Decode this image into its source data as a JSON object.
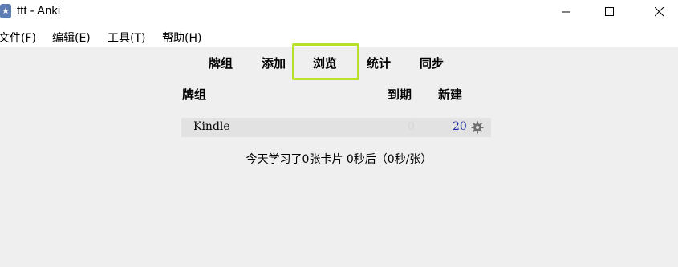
{
  "window": {
    "title": "ttt - Anki",
    "icon": "anki-star-icon"
  },
  "menu": {
    "items": [
      "文件(F)",
      "编辑(E)",
      "工具(T)",
      "帮助(H)"
    ]
  },
  "toolbar": {
    "items": [
      "牌组",
      "添加",
      "浏览",
      "统计",
      "同步"
    ],
    "highlighted": "浏览",
    "highlight_color": "#b8e02a"
  },
  "deck_table": {
    "headers": {
      "deck": "牌组",
      "due": "到期",
      "new": "新建"
    },
    "rows": [
      {
        "name": "Kindle",
        "due": "0",
        "new": "20"
      }
    ],
    "due_color": "#d6d6d6",
    "new_color": "#1f2ba3"
  },
  "stats": {
    "text": "今天学习了0张卡片 0秒后（0秒/张）"
  }
}
